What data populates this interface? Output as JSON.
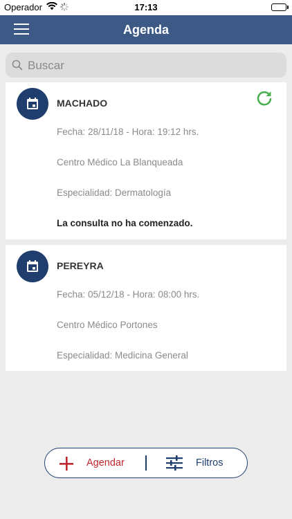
{
  "status_bar": {
    "carrier": "Operador",
    "time": "17:13"
  },
  "nav": {
    "title": "Agenda",
    "menu_icon": "hamburger-menu-icon"
  },
  "search": {
    "placeholder": "Buscar",
    "value": ""
  },
  "appointments": [
    {
      "name": "MACHADO",
      "datetime": "Fecha: 28/11/18 - Hora: 19:12 hrs.",
      "center": "Centro Médico La Blanqueada",
      "specialty": "Especialidad: Dermatología",
      "status": "La consulta no ha comenzado.",
      "icon": "calendar-icon",
      "refresh_icon": "refresh-icon",
      "refresh_color": "#4caf50"
    },
    {
      "name": "PEREYRA",
      "datetime": "Fecha: 05/12/18 - Hora: 08:00 hrs.",
      "center": "Centro Médico Portones",
      "specialty": "Especialidad: Medicina General",
      "icon": "calendar-icon"
    }
  ],
  "actions": {
    "add_label": "Agendar",
    "filter_label": "Filtros",
    "add_color": "#c0262d",
    "primary_color": "#1f3e6e"
  }
}
